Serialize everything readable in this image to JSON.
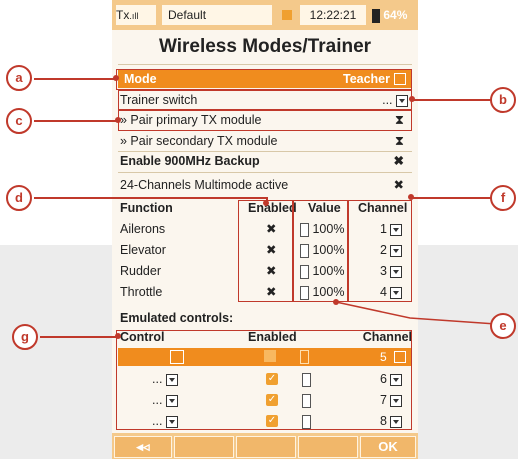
{
  "status": {
    "tx": "Tx",
    "model": "Default",
    "time": "12:22:21",
    "battery": "64%"
  },
  "title": "Wireless Modes/Trainer",
  "rows": {
    "mode_label": "Mode",
    "mode_value": "Teacher",
    "trainer_switch": "Trainer switch",
    "trainer_switch_value": "...",
    "pair_primary": "» Pair primary TX module",
    "pair_secondary": "» Pair secondary TX module",
    "backup": "Enable 900MHz Backup",
    "multimode": "24-Channels Multimode active"
  },
  "table": {
    "headers": {
      "function": "Function",
      "enabled": "Enabled",
      "value": "Value",
      "channel": "Channel"
    },
    "rows": [
      {
        "function": "Ailerons",
        "value": "100%",
        "channel": "1"
      },
      {
        "function": "Elevator",
        "value": "100%",
        "channel": "2"
      },
      {
        "function": "Rudder",
        "value": "100%",
        "channel": "3"
      },
      {
        "function": "Throttle",
        "value": "100%",
        "channel": "4"
      }
    ]
  },
  "emulated": {
    "title": "Emulated controls:",
    "headers": {
      "control": "Control",
      "enabled": "Enabled",
      "channel": "Channel"
    },
    "rows": [
      {
        "control": "",
        "channel": "5"
      },
      {
        "control": "...",
        "channel": "6"
      },
      {
        "control": "...",
        "channel": "7"
      },
      {
        "control": "...",
        "channel": "8"
      }
    ]
  },
  "bottom": {
    "ok": "OK"
  },
  "callouts": [
    "a",
    "b",
    "c",
    "d",
    "e",
    "f",
    "g"
  ],
  "colors": {
    "accent": "#f08c1e",
    "callout": "#c0392b",
    "statusbar": "#f4c98b"
  }
}
